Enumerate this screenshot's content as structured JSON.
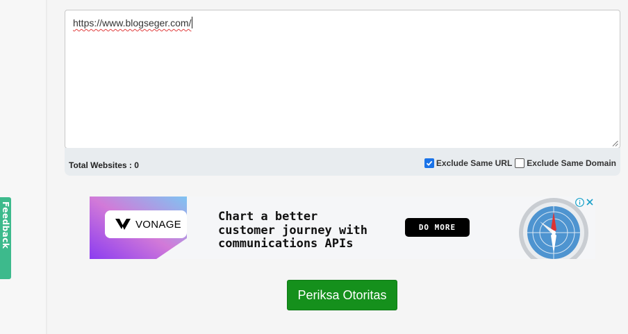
{
  "feedback_tab": {
    "label": "Feedback"
  },
  "url_input": {
    "value": "https://www.blogseger.com/"
  },
  "toolbar": {
    "total_label": "Total Websites : 0",
    "exclude_same_url": {
      "label": "Exclude Same URL",
      "checked": true
    },
    "exclude_same_domain": {
      "label": "Exclude Same Domain",
      "checked": false
    }
  },
  "ad": {
    "brand": "VONAGE",
    "headline_lines": [
      "Chart a better",
      "customer journey with",
      "communications APIs"
    ],
    "cta": "DO MORE"
  },
  "submit_button": {
    "label": "Periksa Otoritas"
  },
  "colors": {
    "primary_green": "#15901c",
    "feedback_green": "#3dba8c",
    "checkbox_blue": "#1a73e8"
  }
}
